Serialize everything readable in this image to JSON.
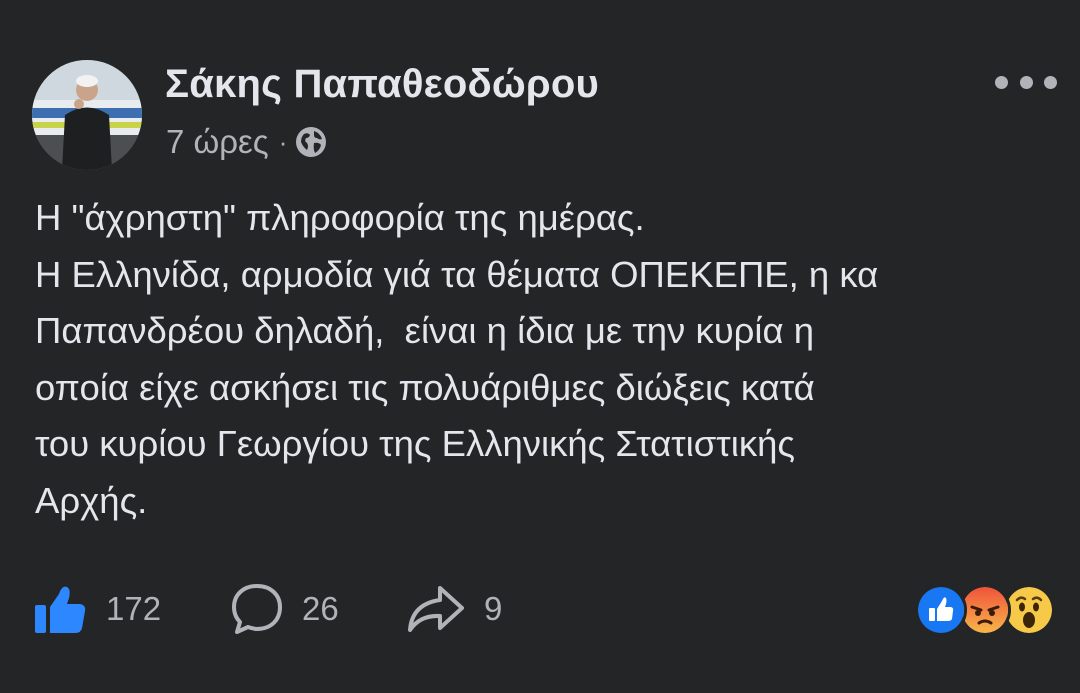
{
  "post": {
    "author": {
      "name": "Σάκης Παπαθεοδώρου",
      "avatar_icon": "profile-photo"
    },
    "time": "7 ώρες",
    "separator": "·",
    "audience_icon": "globe-icon",
    "more_icon": "more-options-icon",
    "text_lines": [
      "Η \"άχρηστη\" πληροφορία της ημέρας.",
      "Η Ελληνίδα, αρμοδία γιά τα θέματα ΟΠΕΚΕΠΕ, η κα",
      "Παπανδρέου δηλαδή,  είναι η ίδια με την κυρία η",
      "οποία είχε ασκήσει τις πολυάριθμες διώξεις κατά",
      "του κυρίου Γεωργίου της Ελληνικής Στατιστικής",
      "Αρχής."
    ],
    "actions": {
      "likes": "172",
      "comments": "26",
      "shares": "9"
    },
    "reactions": [
      "like",
      "angry",
      "wow"
    ],
    "colors": {
      "background": "#242526",
      "primary_text": "#e4e6eb",
      "secondary_text": "#b0b3b8",
      "accent": "#2d88ff"
    }
  }
}
